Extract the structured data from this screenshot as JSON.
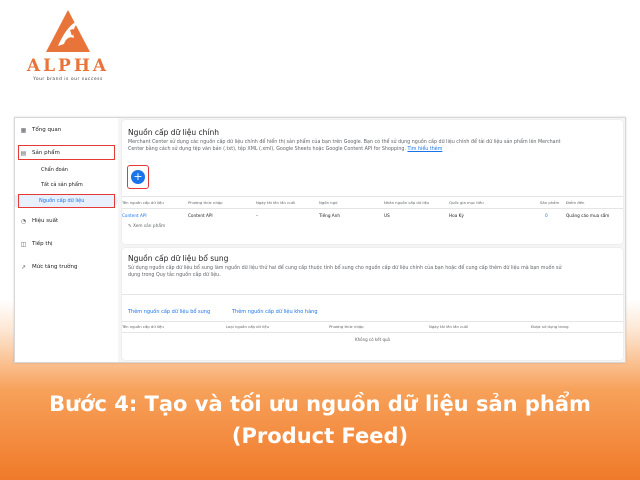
{
  "brand": {
    "name": "ALPHA",
    "tagline": "Your brand is our success",
    "color": "#e8743a"
  },
  "sidebar": {
    "items": [
      {
        "label": "Tổng quan",
        "icon": "grid-icon"
      },
      {
        "label": "Sản phẩm",
        "icon": "product-icon"
      },
      {
        "label": "Hiệu suất",
        "icon": "performance-icon"
      },
      {
        "label": "Tiếp thị",
        "icon": "marketing-icon"
      },
      {
        "label": "Mức tăng trưởng",
        "icon": "growth-icon"
      }
    ],
    "sub_items": [
      {
        "label": "Chẩn đoán"
      },
      {
        "label": "Tất cả sản phẩm"
      }
    ],
    "active": {
      "label": "Nguồn cấp dữ liệu"
    }
  },
  "primary": {
    "title": "Nguồn cấp dữ liệu chính",
    "desc_line1": "Merchant Center sử dụng các nguồn cấp dữ liệu chính để hiển thị sản phẩm của bạn trên Google. Bạn có thể sử dụng nguồn cấp dữ liệu chính để tải dữ liệu sản phẩm lên Merchant",
    "desc_line2": "Center bằng cách sử dụng tệp văn bản (.txt), tệp XML (.xml), Google Sheets hoặc Google Content API for Shopping.",
    "learn_more": "Tìm hiểu thêm",
    "add_button": "+",
    "columns": [
      "Tên nguồn cấp dữ liệu",
      "Phương thức nhập",
      "Ngày tải lên lần cuối",
      "Ngôn ngữ",
      "Nhãn nguồn cấp dữ liệu",
      "Quốc gia mục tiêu",
      "Sản phẩm",
      "Điểm đến"
    ],
    "row": [
      "Content API",
      "Content API",
      "–",
      "Tiếng Anh",
      "US",
      "Hoa Kỳ",
      "0",
      "Quảng cáo mua sắm"
    ],
    "view_products": "Xem sản phẩm"
  },
  "supplemental": {
    "title": "Nguồn cấp dữ liệu bổ sung",
    "desc_line1": "Sử dụng nguồn cấp dữ liệu bổ sung làm nguồn dữ liệu thứ hai để cung cấp thuộc tính bổ sung cho nguồn cấp dữ liệu chính của bạn hoặc để cung cấp thêm dữ liệu mà bạn muốn sử",
    "desc_line2": "dụng trong Quy tắc nguồn cấp dữ liệu.",
    "add_supplemental": "Thêm nguồn cấp dữ liệu bổ sung",
    "add_inventory": "Thêm nguồn cấp dữ liệu kho hàng",
    "columns": [
      "Tên nguồn cấp dữ liệu",
      "Loại nguồn cấp dữ liệu",
      "Phương thức nhập",
      "Ngày tải lên lần cuối",
      "Được sử dụng trong"
    ],
    "empty": "Không có kết quả"
  },
  "caption": {
    "line1": "Bước 4: Tạo và tối ưu nguồn dữ liệu sản phẩm",
    "line2": "(Product Feed)"
  }
}
